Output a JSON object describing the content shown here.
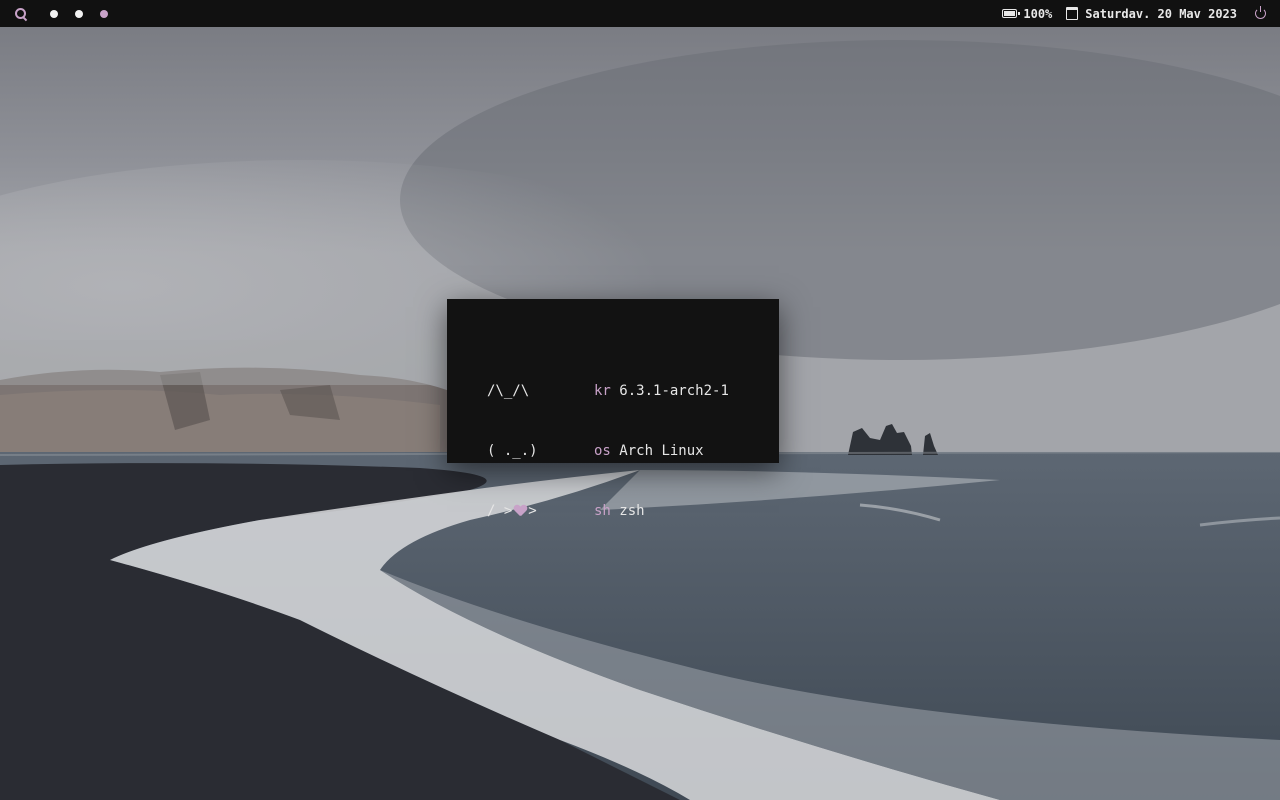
{
  "topbar": {
    "search_icon": "search-icon",
    "workspaces": [
      {
        "color": "#f2f2f2"
      },
      {
        "color": "#f2f2f2"
      },
      {
        "color": "#c8a2c8"
      }
    ],
    "battery_icon": "battery-icon",
    "battery_text": "100%",
    "calendar_icon": "calendar-icon",
    "date_text": "Saturdav. 20 Mav 2023",
    "power_icon": "power-icon",
    "accent_color": "#c8a2c8"
  },
  "terminal": {
    "art": {
      "line1": "/\\_/\\",
      "line2": "( ._.)",
      "line3_left": "/ >",
      "heart_icon": "heart-icon",
      "line3_right": ">"
    },
    "info": [
      {
        "key": "kr",
        "value": "6.3.1-arch2-1"
      },
      {
        "key": "os",
        "value": "Arch Linux"
      },
      {
        "key": "sh",
        "value": "zsh"
      }
    ]
  }
}
